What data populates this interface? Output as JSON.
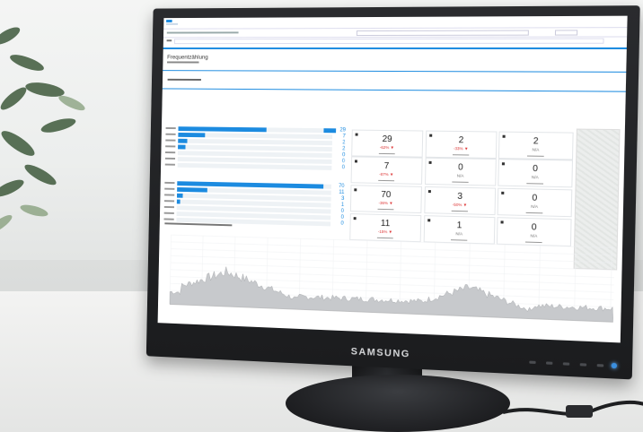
{
  "monitor": {
    "brand": "SAMSUNG"
  },
  "dashboard": {
    "title": "Frequentzählung",
    "kpi_rows": [
      [
        {
          "value": "29",
          "delta": "-62% ▼"
        },
        {
          "value": "2",
          "delta": "-33% ▼"
        },
        {
          "value": "2",
          "delta": "N/A"
        }
      ],
      [
        {
          "value": "7",
          "delta": "-87% ▼"
        },
        {
          "value": "0",
          "delta": "N/A"
        },
        {
          "value": "0",
          "delta": "N/A"
        }
      ],
      [
        {
          "value": "70",
          "delta": "-36% ▼"
        },
        {
          "value": "3",
          "delta": "-50% ▼"
        },
        {
          "value": "0",
          "delta": "N/A"
        }
      ],
      [
        {
          "value": "11",
          "delta": "-15% ▼"
        },
        {
          "value": "1",
          "delta": "N/A"
        },
        {
          "value": "0",
          "delta": "N/A"
        }
      ]
    ],
    "bar_group_1": {
      "fractions": [
        0.58,
        0.18,
        0.06,
        0.05,
        0.0,
        0.0,
        0.0
      ],
      "numbers": [
        "29",
        "7",
        "2",
        "2",
        "0",
        "0",
        "0"
      ]
    },
    "bar_group_2": {
      "fractions": [
        0.95,
        0.2,
        0.04,
        0.02,
        0.0,
        0.0,
        0.0
      ],
      "numbers": [
        "70",
        "11",
        "3",
        "1",
        "0",
        "0",
        "0"
      ]
    }
  },
  "colors": {
    "accent": "#1c8be0",
    "negative": "#d33333"
  }
}
